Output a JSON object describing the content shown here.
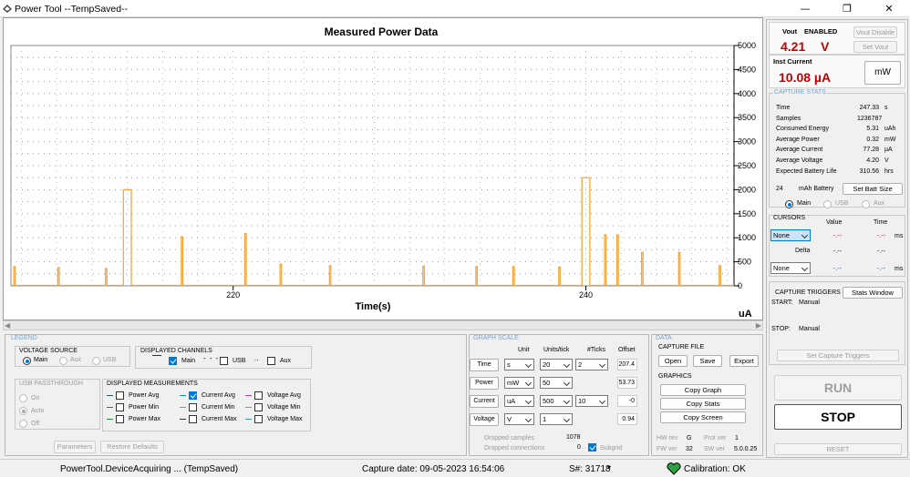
{
  "window": {
    "title": "Power Tool --TempSaved--",
    "minimize": "—",
    "maximize": "❐",
    "close": "✕"
  },
  "chart": {
    "title": "Measured Power Data",
    "xlabel": "Time(s)",
    "unit": "uA"
  },
  "chart_data": {
    "type": "line",
    "title": "Measured Power Data",
    "xlabel": "Time(s)",
    "ylabel": "uA",
    "xlim": [
      207.4,
      248.4
    ],
    "ylim": [
      0,
      5000
    ],
    "xticks": [
      220,
      240
    ],
    "yticks": [
      0,
      500,
      1000,
      1500,
      2000,
      2500,
      3000,
      3500,
      4000,
      4500,
      5000
    ],
    "grid": true,
    "series": [
      {
        "name": "Current Avg",
        "color": "#f5a030",
        "baseline": 10,
        "x": [
          207.6,
          210.1,
          212.8,
          214.0,
          217.1,
          220.7,
          222.7,
          225.5,
          230.8,
          233.8,
          235.9,
          238.5,
          240.0,
          241.1,
          241.8,
          243.2,
          245.3,
          247.6
        ],
        "y": [
          400,
          380,
          360,
          2000,
          1020,
          1090,
          450,
          420,
          410,
          400,
          400,
          390,
          2250,
          1060,
          1060,
          700,
          700,
          420
        ],
        "w": [
          0.08,
          0.08,
          0.08,
          0.45,
          0.08,
          0.08,
          0.08,
          0.08,
          0.08,
          0.08,
          0.08,
          0.08,
          0.45,
          0.08,
          0.08,
          0.08,
          0.08,
          0.08
        ]
      }
    ]
  },
  "vout": {
    "label": "Vout",
    "state": "ENABLED",
    "value": "4.21",
    "unit": "V",
    "disable_btn": "Vout Disable",
    "set_btn": "Set Vout"
  },
  "inst": {
    "label": "Inst Current",
    "value": "10.08 µA",
    "mw_btn": "mW"
  },
  "stats": {
    "legend": "CAPTURE STATS",
    "rows": [
      {
        "label": "Time",
        "value": "247.33",
        "unit": "s"
      },
      {
        "label": "Samples",
        "value": "1236787",
        "unit": ""
      },
      {
        "label": "Consumed Energy",
        "value": "5.31",
        "unit": "uAh"
      },
      {
        "label": "Average Power",
        "value": "0.32",
        "unit": "mW"
      },
      {
        "label": "Average Current",
        "value": "77.28",
        "unit": "µA"
      },
      {
        "label": "Average Voltage",
        "value": "4.20",
        "unit": "V"
      },
      {
        "label": "Expected Battery Life",
        "value": "310.56",
        "unit": "hrs"
      }
    ],
    "battery_size": "24",
    "battery_label": "mAh Battery",
    "set_batt_btn": "Set Batt Size",
    "sources": [
      "Main",
      "USB",
      "Aux"
    ]
  },
  "cursors": {
    "legend": "CURSORS",
    "value_hdr": "Value",
    "time_hdr": "Time",
    "delta": "Delta",
    "sel1": "None",
    "sel2": "None",
    "dash": "-.--",
    "ms": "ms"
  },
  "triggers": {
    "legend": "CAPTURE TRIGGERS",
    "stats_btn": "Stats Window",
    "start_label": "START:",
    "start_val": "Manual",
    "stop_label": "STOP:",
    "stop_val": "Manual",
    "set_btn": "Set Capture Triggers"
  },
  "controls": {
    "run": "RUN",
    "stop": "STOP",
    "reset": "RESET"
  },
  "legend_panel": {
    "title": "LEGEND",
    "voltage_source": "VOLTAGE SOURCE",
    "vs_opts": [
      "Main",
      "Aux",
      "USB"
    ],
    "displayed_channels": "DISPLAYED CHANNELS",
    "ch_main": "Main",
    "ch_usb": "USB",
    "ch_aux": "Aux",
    "usb_passthrough": "USB PASSTHROUGH",
    "usb_opts": [
      "On",
      "Auto",
      "Off"
    ],
    "displayed_measurements": "DISPLAYED MEASUREMENTS",
    "measurements": [
      "Power Avg",
      "Power Min",
      "Power Max",
      "Current Avg",
      "Current Min",
      "Current Max",
      "Voltage Avg",
      "Voltage Min",
      "Voltage Max"
    ],
    "params_btn": "Parameters",
    "restore_btn": "Restore Defaults"
  },
  "graph_scale": {
    "title": "GRAPH SCALE",
    "hdr_unit": "Unit",
    "hdr_upt": "Units/tick",
    "hdr_ticks": "#Ticks",
    "hdr_offset": "Offset",
    "rows": [
      {
        "name": "Time",
        "unit": "s",
        "upt": "20",
        "ticks": "2",
        "offset": "207.4"
      },
      {
        "name": "Power",
        "unit": "mW",
        "upt": "50",
        "ticks": "",
        "offset": "53.73"
      },
      {
        "name": "Current",
        "unit": "uA",
        "upt": "500",
        "ticks": "10",
        "offset": "-0"
      },
      {
        "name": "Voltage",
        "unit": "V",
        "upt": "1",
        "ticks": "",
        "offset": "0.94"
      }
    ],
    "dropped_samples_label": "Dropped samples",
    "dropped_samples": "1078",
    "dropped_conn_label": "Dropped connections",
    "dropped_conn": "0",
    "subgrid": "Subgrid"
  },
  "data_panel": {
    "title": "DATA",
    "capture_file": "CAPTURE FILE",
    "open": "Open",
    "save": "Save",
    "export": "Export",
    "graphics": "GRAPHICS",
    "copy_graph": "Copy Graph",
    "copy_stats": "Copy Stats",
    "copy_screen": "Copy Screen",
    "hw_rev_label": "HW rev",
    "hw_rev": "G",
    "prot_label": "Prot ver",
    "prot": "1",
    "fw_label": "FW ver",
    "fw": "32",
    "sw_label": "SW ver",
    "sw": "5.0.0.25"
  },
  "status": {
    "left": "PowerTool.DeviceAcquiring ... (TempSaved)",
    "capture": "Capture date: 09-05-2023 16:54:06",
    "serial": "S#: 31718",
    "calibration": "Calibration: OK"
  }
}
